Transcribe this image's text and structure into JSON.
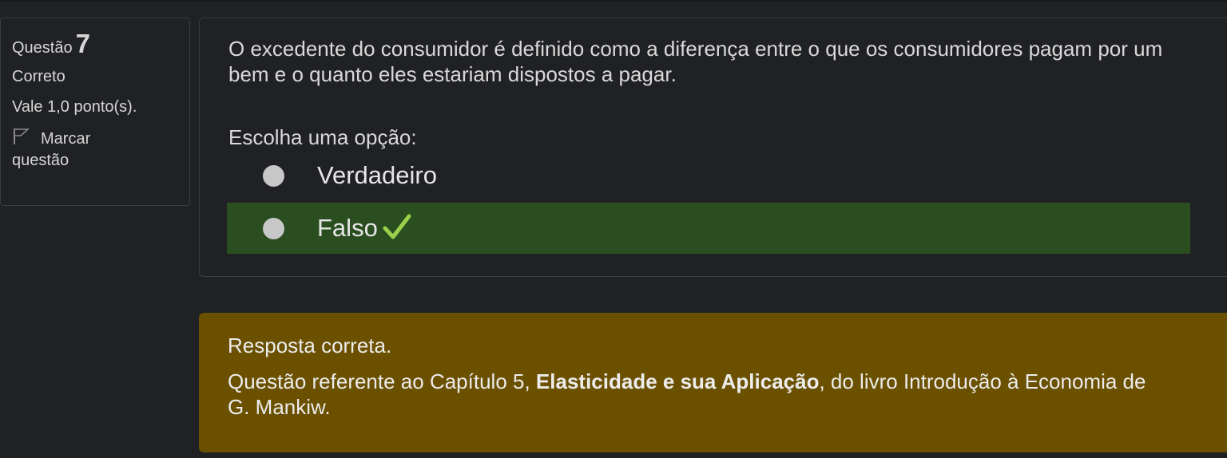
{
  "question_info": {
    "label": "Questão",
    "number": "7",
    "state": "Correto",
    "grade": "Vale 1,0 ponto(s).",
    "flag_label_line1": "Marcar",
    "flag_label_line2": "questão"
  },
  "question": {
    "text": "O excedente do consumidor é definido como a diferença entre o que os consumidores pagam por um bem e o quanto eles estariam dispostos a pagar.",
    "prompt": "Escolha uma opção:",
    "options": [
      {
        "label": "Verdadeiro",
        "selected": false,
        "correct": false
      },
      {
        "label": "Falso",
        "selected": true,
        "correct": true
      }
    ]
  },
  "feedback": {
    "title": "Resposta correta.",
    "text_before": "Questão referente ao Capítulo 5, ",
    "text_bold": "Elasticidade e sua Aplicação",
    "text_after": ", do livro Introdução à Economia de G. Mankiw."
  },
  "colors": {
    "background": "#1f2124",
    "correct_option_bg": "#2b4e20",
    "feedback_bg": "#6b5000",
    "check": "#9ad14b"
  },
  "icons": {
    "flag": "flag-icon",
    "check": "check-icon",
    "radio": "radio-icon"
  }
}
